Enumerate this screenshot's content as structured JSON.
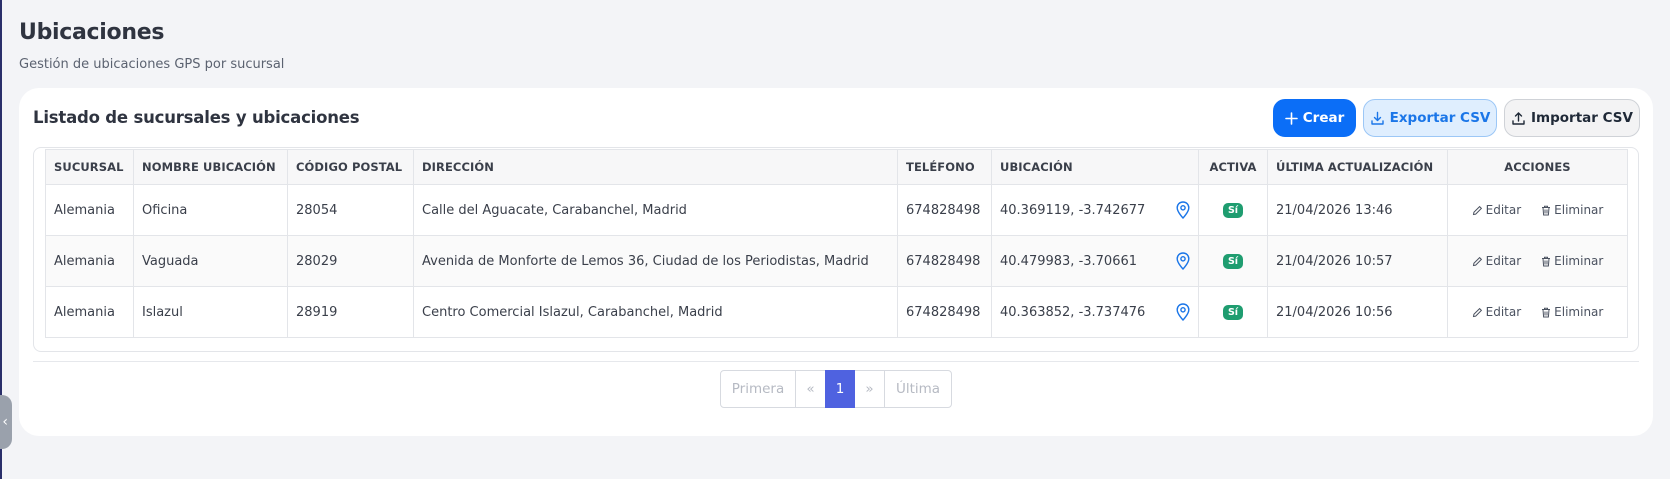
{
  "header": {
    "title": "Ubicaciones",
    "subtitle": "Gestión de ubicaciones GPS por sucursal"
  },
  "card": {
    "title": "Listado de sucursales y ubicaciones",
    "buttons": {
      "create": "Crear",
      "export": "Exportar CSV",
      "import": "Importar CSV"
    }
  },
  "table": {
    "columns": [
      "SUCURSAL",
      "NOMBRE UBICACIÓN",
      "CÓDIGO POSTAL",
      "DIRECCIÓN",
      "TELÉFONO",
      "UBICACIÓN",
      "ACTIVA",
      "ÚLTIMA ACTUALIZACIÓN",
      "ACCIONES"
    ],
    "rows": [
      {
        "sucursal": "Alemania",
        "nombre": "Oficina",
        "codigo_postal": "28054",
        "direccion": "Calle del Aguacate, Carabanchel, Madrid",
        "telefono": "674828498",
        "ubicacion": "40.369119, -3.742677",
        "activa": "Sí",
        "ultima_actualizacion": "21/04/2026 13:46"
      },
      {
        "sucursal": "Alemania",
        "nombre": "Vaguada",
        "codigo_postal": "28029",
        "direccion": "Avenida de Monforte de Lemos 36, Ciudad de los Periodistas, Madrid",
        "telefono": "674828498",
        "ubicacion": "40.479983, -3.70661",
        "activa": "Sí",
        "ultima_actualizacion": "21/04/2026 10:57"
      },
      {
        "sucursal": "Alemania",
        "nombre": "Islazul",
        "codigo_postal": "28919",
        "direccion": "Centro Comercial Islazul, Carabanchel, Madrid",
        "telefono": "674828498",
        "ubicacion": "40.363852, -3.737476",
        "activa": "Sí",
        "ultima_actualizacion": "21/04/2026 10:56"
      }
    ],
    "actions": {
      "edit": "Editar",
      "delete": "Eliminar"
    }
  },
  "pagination": {
    "first": "Primera",
    "prev": "«",
    "current": "1",
    "next": "»",
    "last": "Última"
  },
  "colors": {
    "primary": "#0b6ef7",
    "export_bg": "#dfeefe",
    "active_badge": "#1f9d70",
    "page_active": "#4f62e0"
  },
  "icons": {
    "create": "plus-icon",
    "export": "download-icon",
    "import": "upload-icon",
    "location": "map-pin-icon",
    "edit": "pencil-icon",
    "delete": "trash-icon",
    "sidebar_toggle": "chevron-left-icon"
  }
}
